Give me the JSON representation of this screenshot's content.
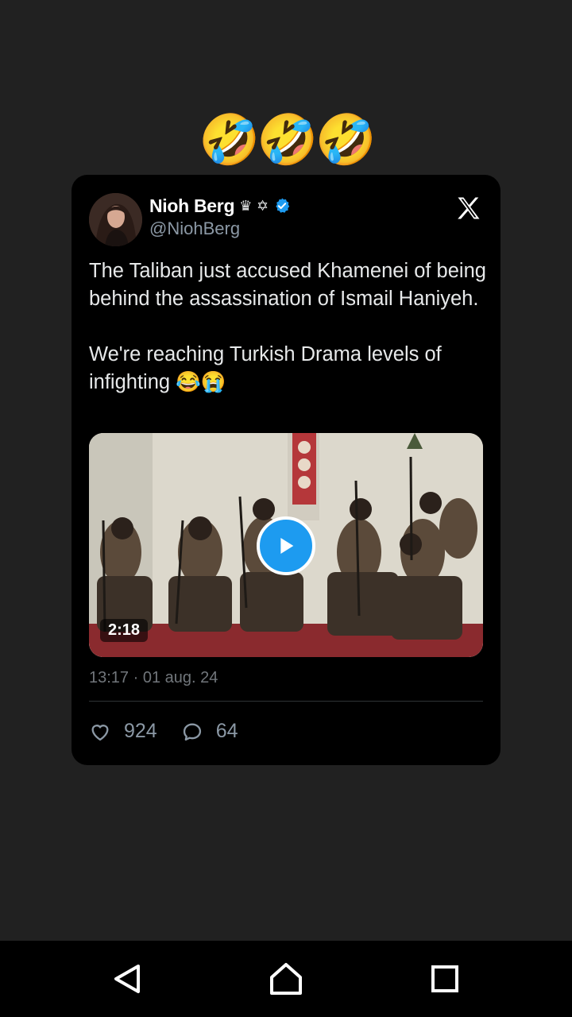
{
  "reaction": {
    "emojis": "🤣🤣🤣"
  },
  "tweet": {
    "display_name": "Nioh Berg",
    "name_emojis": "♛ ✡",
    "handle": "@NiohBerg",
    "text": "The Taliban just accused Khamenei of being behind the assassination of Ismail Haniyeh.\n\nWe're reaching Turkish Drama levels of infighting 😂😭",
    "video_duration": "2:18",
    "timestamp": "13:17 · 01 aug. 24",
    "likes": "924",
    "replies": "64",
    "verified_color": "#1d9bf0",
    "brand_icon": "x-logo-icon"
  },
  "navbar": {
    "back_icon": "back-triangle-icon",
    "home_icon": "home-icon",
    "recents_icon": "recents-square-icon"
  }
}
